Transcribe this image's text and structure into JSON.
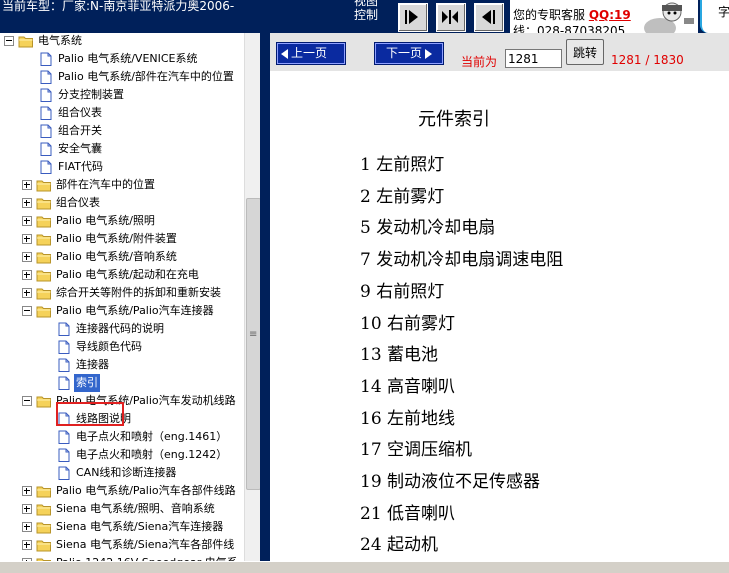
{
  "topbar": {
    "car_model": "当前车型：厂家:N-南京菲亚特派力奥2006-",
    "view_control": "视图控制",
    "service_text": "您的专职客服",
    "service_qq": "QQ:19",
    "service_phone": "线：028-87038205",
    "right_chip": "字"
  },
  "tree": {
    "items": [
      {
        "label": "电气系统",
        "level": 0,
        "type": "folder",
        "expander": "minus"
      },
      {
        "label": "Palio 电气系统/VENICE系统",
        "level": 1,
        "type": "doc"
      },
      {
        "label": "Palio 电气系统/部件在汽车中的位置",
        "level": 1,
        "type": "doc"
      },
      {
        "label": "分支控制装置",
        "level": 1,
        "type": "doc"
      },
      {
        "label": "组合仪表",
        "level": 1,
        "type": "doc"
      },
      {
        "label": "组合开关",
        "level": 1,
        "type": "doc"
      },
      {
        "label": "安全气囊",
        "level": 1,
        "type": "doc"
      },
      {
        "label": "FIAT代码",
        "level": 1,
        "type": "doc"
      },
      {
        "label": "部件在汽车中的位置",
        "level": 1,
        "type": "folder",
        "expander": "plus"
      },
      {
        "label": "组合仪表",
        "level": 1,
        "type": "folder",
        "expander": "plus"
      },
      {
        "label": "Palio 电气系统/照明",
        "level": 1,
        "type": "folder",
        "expander": "plus"
      },
      {
        "label": "Palio 电气系统/附件装置",
        "level": 1,
        "type": "folder",
        "expander": "plus"
      },
      {
        "label": "Palio 电气系统/音响系统",
        "level": 1,
        "type": "folder",
        "expander": "plus"
      },
      {
        "label": "Palio 电气系统/起动和在充电",
        "level": 1,
        "type": "folder",
        "expander": "plus"
      },
      {
        "label": "综合开关等附件的拆卸和重新安装",
        "level": 1,
        "type": "folder",
        "expander": "plus"
      },
      {
        "label": "Palio 电气系统/Palio汽车连接器",
        "level": 1,
        "type": "folder",
        "expander": "minus"
      },
      {
        "label": "连接器代码的说明",
        "level": 2,
        "type": "doc"
      },
      {
        "label": "导线颜色代码",
        "level": 2,
        "type": "doc"
      },
      {
        "label": "连接器",
        "level": 2,
        "type": "doc"
      },
      {
        "label": "索引",
        "level": 2,
        "type": "doc",
        "selected": true
      },
      {
        "label": "Palio 电气系统/Palio汽车发动机线路",
        "level": 1,
        "type": "folder",
        "expander": "minus"
      },
      {
        "label": "线路图说明",
        "level": 2,
        "type": "doc"
      },
      {
        "label": "电子点火和喷射（eng.1461）",
        "level": 2,
        "type": "doc"
      },
      {
        "label": "电子点火和喷射（eng.1242）",
        "level": 2,
        "type": "doc"
      },
      {
        "label": "CAN线和诊断连接器",
        "level": 2,
        "type": "doc"
      },
      {
        "label": "Palio 电气系统/Palio汽车各部件线路",
        "level": 1,
        "type": "folder",
        "expander": "plus"
      },
      {
        "label": "Siena 电气系统/照明、音响系统",
        "level": 1,
        "type": "folder",
        "expander": "plus"
      },
      {
        "label": "Siena 电气系统/Siena汽车连接器",
        "level": 1,
        "type": "folder",
        "expander": "plus"
      },
      {
        "label": "Siena 电气系统/Siena汽车各部件线",
        "level": 1,
        "type": "folder",
        "expander": "plus"
      },
      {
        "label": "Palio 1242 16V Speedgear 电气系",
        "level": 1,
        "type": "folder",
        "expander": "plus"
      }
    ]
  },
  "pager": {
    "prev_label": "上一页",
    "next_label": "下一页",
    "current_label": "当前为",
    "page_value": "1281",
    "jump_label": "跳转",
    "page_count": "1281 / 1830"
  },
  "document": {
    "title": "元件索引",
    "entries": [
      "1 左前照灯",
      "2 左前雾灯",
      "5 发动机冷却电扇",
      "7 发动机冷却电扇调速电阻",
      "9 右前照灯",
      "10 右前雾灯",
      "13 蓄电池",
      "14 高音喇叭",
      "16 左前地线",
      "17 空调压缩机",
      "19 制动液位不足传感器",
      "21 低音喇叭",
      "24 起动机"
    ]
  },
  "colors": {
    "topbar_bg": "#00205a",
    "pager_button": "#0a2aa0",
    "page_text": "#e00000",
    "selection": "#3366cc",
    "highlight_box": "#e02020"
  }
}
